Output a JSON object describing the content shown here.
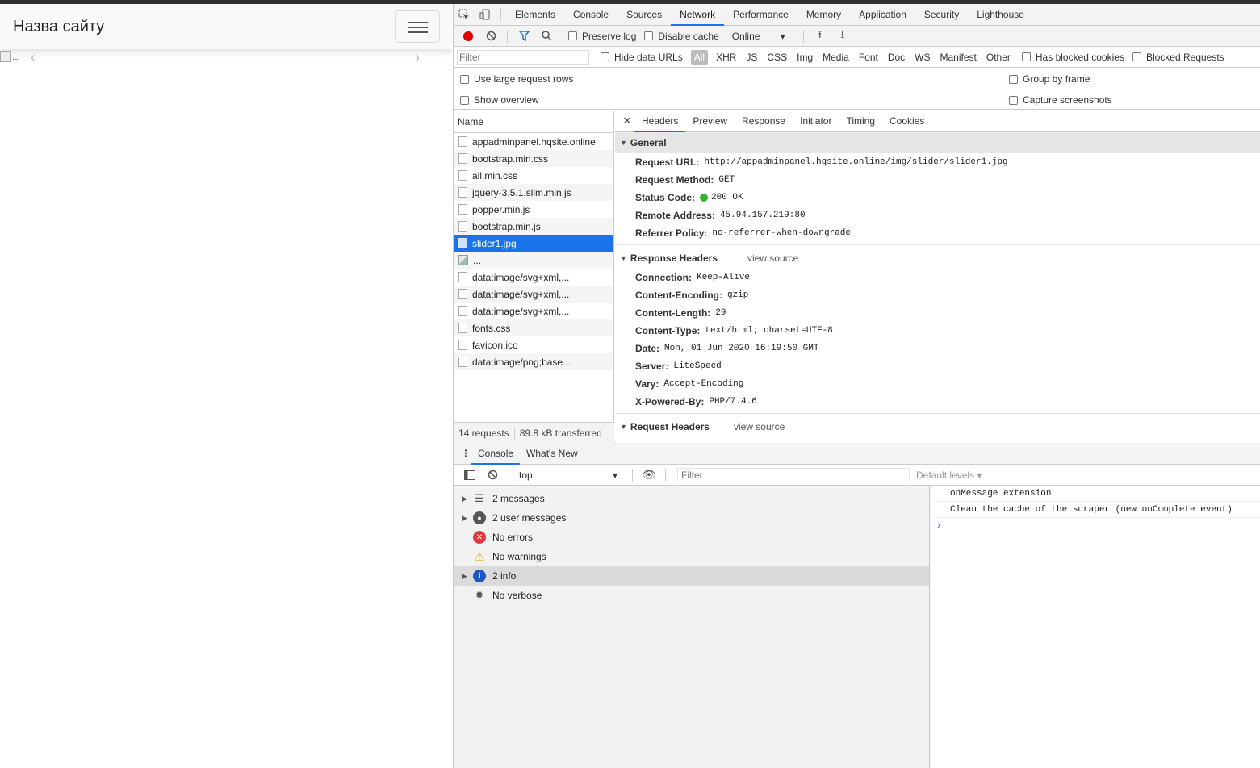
{
  "site": {
    "brand": "Назва сайту",
    "broken_image_alt": "..."
  },
  "devtools": {
    "tabs": [
      "Elements",
      "Console",
      "Sources",
      "Network",
      "Performance",
      "Memory",
      "Application",
      "Security",
      "Lighthouse"
    ],
    "active_tab": "Network",
    "toolbar": {
      "preserve_log": "Preserve log",
      "disable_cache": "Disable cache",
      "throttling": "Online"
    },
    "filterbar": {
      "placeholder": "Filter",
      "hide_data_urls": "Hide data URLs",
      "types": [
        "All",
        "XHR",
        "JS",
        "CSS",
        "Img",
        "Media",
        "Font",
        "Doc",
        "WS",
        "Manifest",
        "Other"
      ],
      "has_blocked_cookies": "Has blocked cookies",
      "blocked_requests": "Blocked Requests"
    },
    "settings": {
      "large_rows": "Use large request rows",
      "show_overview": "Show overview",
      "group_by_frame": "Group by frame",
      "capture_screenshots": "Capture screenshots"
    },
    "requests": {
      "column_name": "Name",
      "items": [
        "appadminpanel.hqsite.online",
        "bootstrap.min.css",
        "all.min.css",
        "jquery-3.5.1.slim.min.js",
        "popper.min.js",
        "bootstrap.min.js",
        "slider1.jpg",
        "...",
        "data:image/svg+xml,...",
        "data:image/svg+xml,...",
        "data:image/svg+xml,...",
        "fonts.css",
        "favicon.ico",
        "data:image/png;base..."
      ],
      "selected_index": 6,
      "footer_count": "14 requests",
      "footer_transferred": "89.8 kB transferred"
    },
    "detail": {
      "tabs": [
        "Headers",
        "Preview",
        "Response",
        "Initiator",
        "Timing",
        "Cookies"
      ],
      "active_tab": "Headers",
      "general_title": "General",
      "general": [
        {
          "k": "Request URL:",
          "v": "http://appadminpanel.hqsite.online/img/slider/slider1.jpg"
        },
        {
          "k": "Request Method:",
          "v": "GET"
        },
        {
          "k": "Status Code:",
          "v": "200 OK"
        },
        {
          "k": "Remote Address:",
          "v": "45.94.157.219:80"
        },
        {
          "k": "Referrer Policy:",
          "v": "no-referrer-when-downgrade"
        }
      ],
      "response_title": "Response Headers",
      "view_source": "view source",
      "response": [
        {
          "k": "Connection:",
          "v": "Keep-Alive"
        },
        {
          "k": "Content-Encoding:",
          "v": "gzip"
        },
        {
          "k": "Content-Length:",
          "v": "29"
        },
        {
          "k": "Content-Type:",
          "v": "text/html; charset=UTF-8"
        },
        {
          "k": "Date:",
          "v": "Mon, 01 Jun 2020 16:19:50 GMT"
        },
        {
          "k": "Server:",
          "v": "LiteSpeed"
        },
        {
          "k": "Vary:",
          "v": "Accept-Encoding"
        },
        {
          "k": "X-Powered-By:",
          "v": "PHP/7.4.6"
        }
      ],
      "request_title": "Request Headers"
    },
    "drawer": {
      "tabs": [
        "Console",
        "What's New"
      ],
      "context": "top",
      "filter_placeholder": "Filter",
      "levels": "Default levels ▾",
      "sidebar": [
        {
          "label": "2 messages",
          "icon": "list-icon",
          "arrow": true
        },
        {
          "label": "2 user messages",
          "icon": "user-icon",
          "arrow": true
        },
        {
          "label": "No errors",
          "icon": "error-icon",
          "arrow": false
        },
        {
          "label": "No warnings",
          "icon": "warning-icon",
          "arrow": false
        },
        {
          "label": "2 info",
          "icon": "info-icon",
          "arrow": true
        },
        {
          "label": "No verbose",
          "icon": "bug-icon",
          "arrow": false
        }
      ],
      "messages": [
        "onMessage extension",
        "Clean the cache of the scraper (new onComplete event)"
      ]
    },
    "colors": {
      "accent": "#1a73e8",
      "record": "#e10000",
      "status_ok": "#2db52d"
    }
  }
}
